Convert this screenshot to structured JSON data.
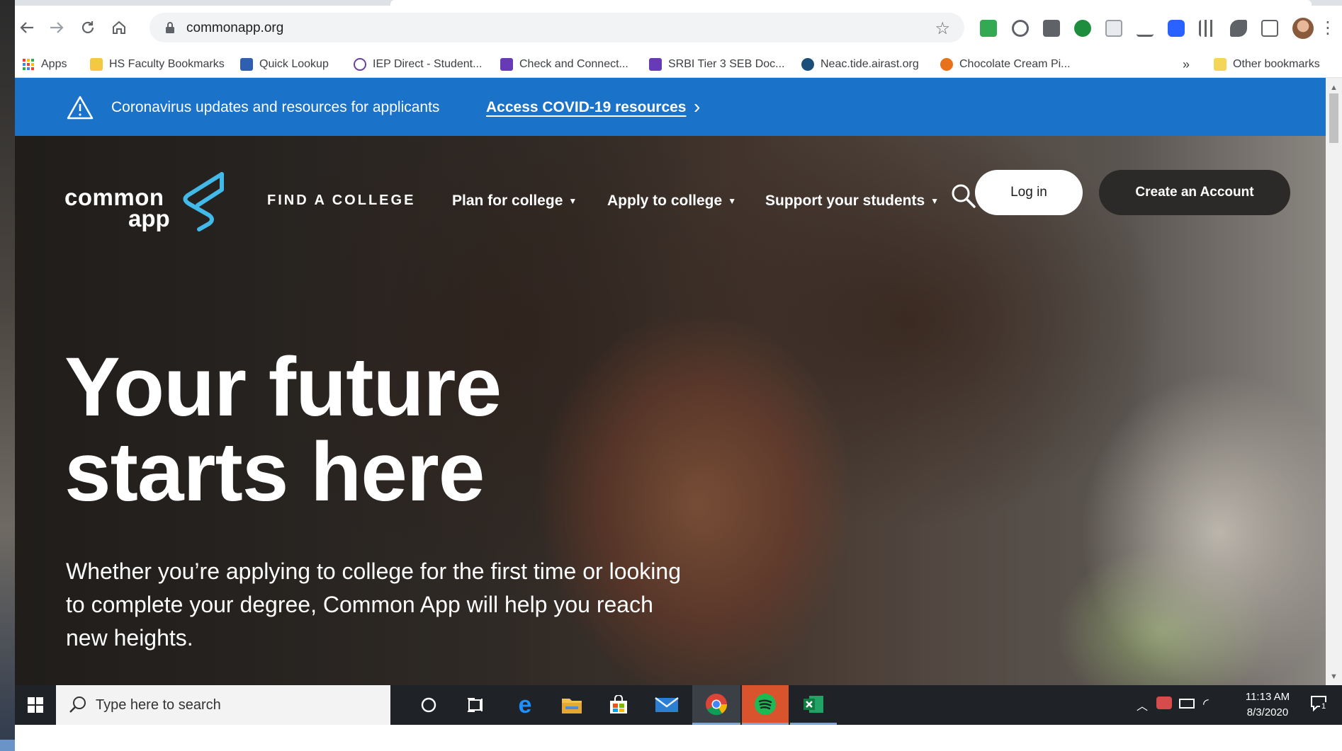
{
  "browser": {
    "url": "commonapp.org",
    "bookmarks": [
      {
        "label": "Apps",
        "icon": "apps-grid-icon",
        "color": "#ea4335"
      },
      {
        "label": "HS Faculty Bookmarks",
        "icon": "folder-icon",
        "color": "#f4c842"
      },
      {
        "label": "Quick Lookup",
        "icon": "quick-lookup-icon",
        "color": "#2f5fb3"
      },
      {
        "label": "IEP Direct - Student...",
        "icon": "iep-icon",
        "color": "#6b3fa0"
      },
      {
        "label": "Check and Connect...",
        "icon": "form-icon",
        "color": "#673ab7"
      },
      {
        "label": "SRBI Tier 3 SEB Doc...",
        "icon": "form-icon",
        "color": "#673ab7"
      },
      {
        "label": "Neac.tide.airast.org",
        "icon": "globe-icon",
        "color": "#1b4f7a"
      },
      {
        "label": "Chocolate Cream Pi...",
        "icon": "recipe-icon",
        "color": "#e8711c"
      }
    ],
    "other_bookmarks": "Other bookmarks",
    "more": "»"
  },
  "banner": {
    "message": "Coronavirus updates and resources for applicants",
    "link": "Access COVID-19 resources"
  },
  "site": {
    "logo_line1": "common",
    "logo_line2": "app",
    "nav": [
      {
        "label": "FIND A COLLEGE"
      },
      {
        "label": "Plan for college"
      },
      {
        "label": "Apply to college"
      },
      {
        "label": "Support your students"
      }
    ],
    "login": "Log in",
    "create_account": "Create an Account",
    "headline_line1": "Your future",
    "headline_line2": "starts here",
    "subtext": "Whether you’re applying to college for the first time or looking to complete your degree, Common App will help you reach new heights.",
    "accent_color": "#42b9e8",
    "banner_color": "#1a73c8"
  },
  "taskbar": {
    "search_placeholder": "Type here to search",
    "time": "11:13 AM",
    "date": "8/3/2020",
    "notification_count": "1"
  }
}
